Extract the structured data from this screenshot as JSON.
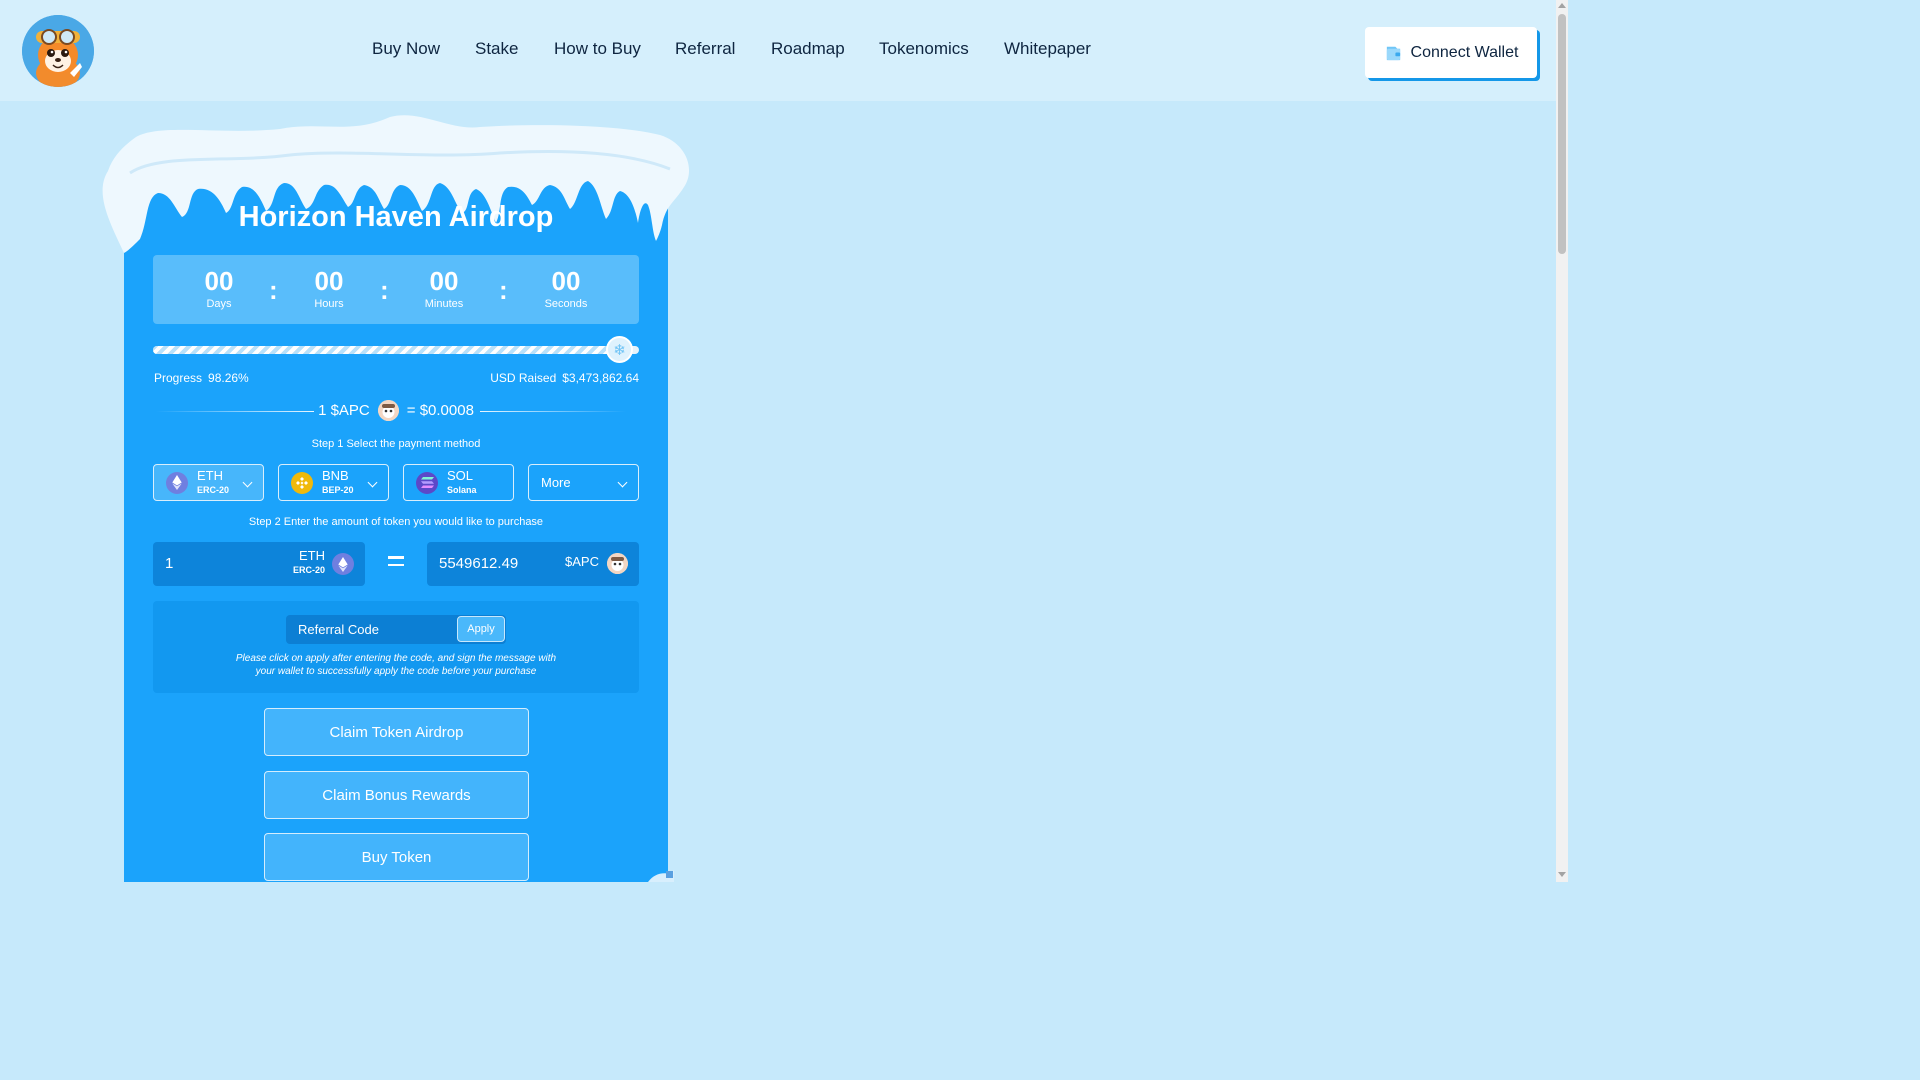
{
  "header": {
    "nav": [
      "Buy Now",
      "Stake",
      "How to Buy",
      "Referral",
      "Roadmap",
      "Tokenomics",
      "Whitepaper"
    ],
    "connect_label": "Connect Wallet",
    "logo_icon": "mascot-logo-icon",
    "wallet_icon": "wallet-icon"
  },
  "presale": {
    "title": "Horizon Haven Airdrop",
    "countdown": {
      "days": "00",
      "days_label": "Days",
      "hours": "00",
      "hours_label": "Hours",
      "minutes": "00",
      "minutes_label": "Minutes",
      "seconds": "00",
      "seconds_label": "Seconds",
      "separator": ":"
    },
    "progress_label": "Progress",
    "progress_value": "98.26%",
    "progress_fraction": 0.9826,
    "raised_label": "USD Raised",
    "raised_value": "$3,473,862.64",
    "rate_left": "1 $APC",
    "rate_right": "= $0.0008",
    "step1": "Step 1 Select the payment method",
    "payment_methods": [
      {
        "symbol": "ETH",
        "network": "ERC-20",
        "icon": "ethereum-icon",
        "color": "#6f7fe0"
      },
      {
        "symbol": "BNB",
        "network": "BEP-20",
        "icon": "bnb-icon",
        "color": "#f0b90b"
      },
      {
        "symbol": "SOL",
        "network": "Solana",
        "icon": "solana-icon",
        "color": "#5c48c8"
      },
      {
        "symbol": "More",
        "network": "",
        "icon": "",
        "color": ""
      }
    ],
    "step2": "Step 2 Enter the amount of token you would like to purchase",
    "pay_amount": "1",
    "pay_symbol": "ETH",
    "pay_network": "ERC-20",
    "receive_amount": "5549612.49",
    "receive_symbol": "$APC",
    "referral_placeholder": "Referral Code",
    "apply_label": "Apply",
    "referral_note_line1": "Please click on apply after entering the code, and sign the message with",
    "referral_note_line2": "your wallet to successfully apply the code before your purchase",
    "buttons": {
      "claim_airdrop": "Claim Token Airdrop",
      "claim_bonus": "Claim Bonus Rewards",
      "buy": "Buy Token"
    }
  },
  "colors": {
    "background": "#c6e9fb",
    "card": "#1ba3fb",
    "accent_shadow": "#1497e8"
  }
}
